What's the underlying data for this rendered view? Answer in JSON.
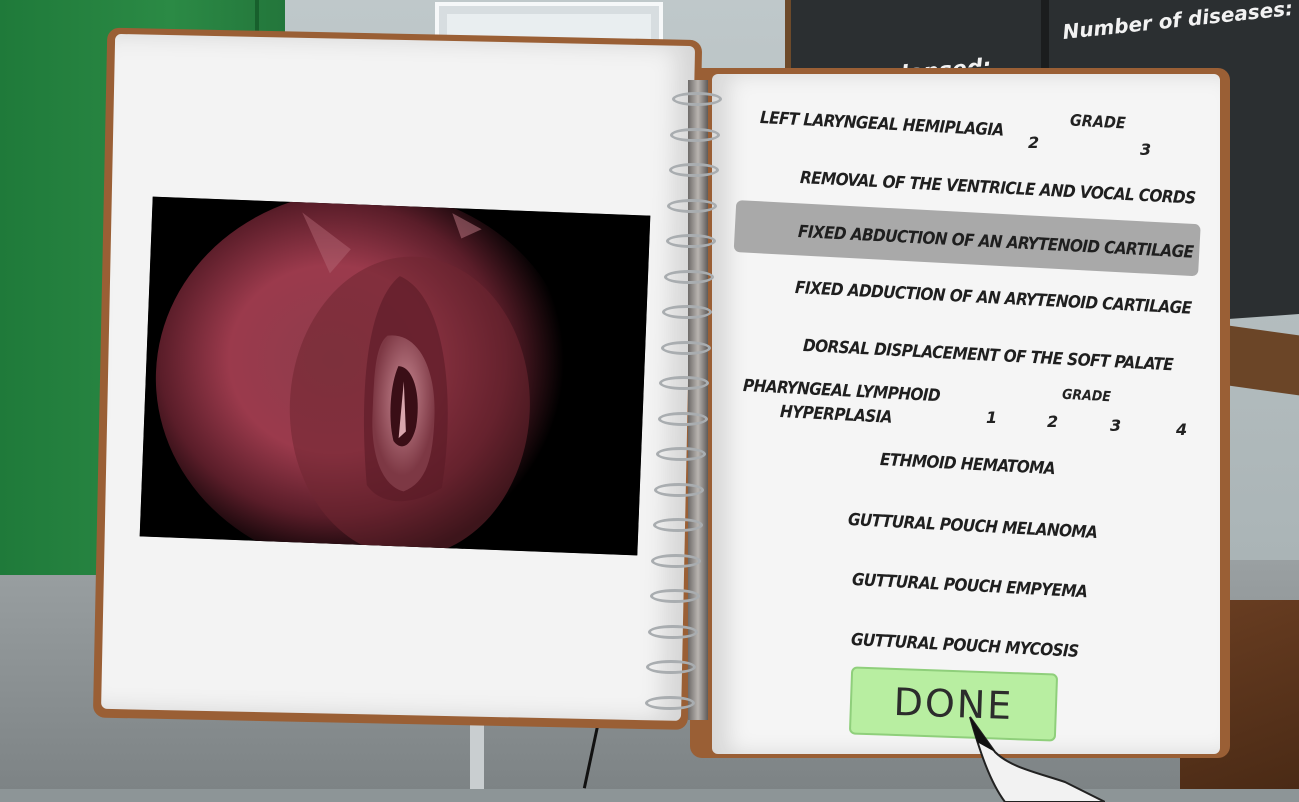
{
  "blackboard": {
    "line1": "Number of diseases:",
    "line2": "Time elapsed:"
  },
  "diagnoses": [
    {
      "label": "Left laryngeal hemiplagia"
    },
    {
      "label": "Removal of the ventricle and vocal cords"
    },
    {
      "label": "Fixed abduction of an arytenoid cartilage",
      "selected": true
    },
    {
      "label": "Fixed adduction of an arytenoid cartilage"
    },
    {
      "label": "Dorsal displacement of the soft palate"
    },
    {
      "label": "Pharyngeal lymphoid hyperplasia"
    },
    {
      "label": "Ethmoid hematoma"
    },
    {
      "label": "Guttural pouch melanoma"
    },
    {
      "label": "Guttural pouch empyema"
    },
    {
      "label": "Guttural pouch mycosis"
    }
  ],
  "hemiplagia_grade": {
    "label": "Grade",
    "options": [
      "2",
      "3"
    ]
  },
  "pharyngeal_label_line1": "Pharyngeal lymphoid",
  "pharyngeal_label_line2": "hyperplasia",
  "lymphoid_grade": {
    "label": "Grade",
    "options": [
      "1",
      "2",
      "3",
      "4"
    ]
  },
  "done_button": "DONE",
  "colors": {
    "page": "#f5f5f5",
    "cover": "#9a5f35",
    "selected_row": "#a9a9a9",
    "done_button": "#b8eea1",
    "wall_green": "#2b8a45",
    "blackboard": "#2b2f31"
  }
}
